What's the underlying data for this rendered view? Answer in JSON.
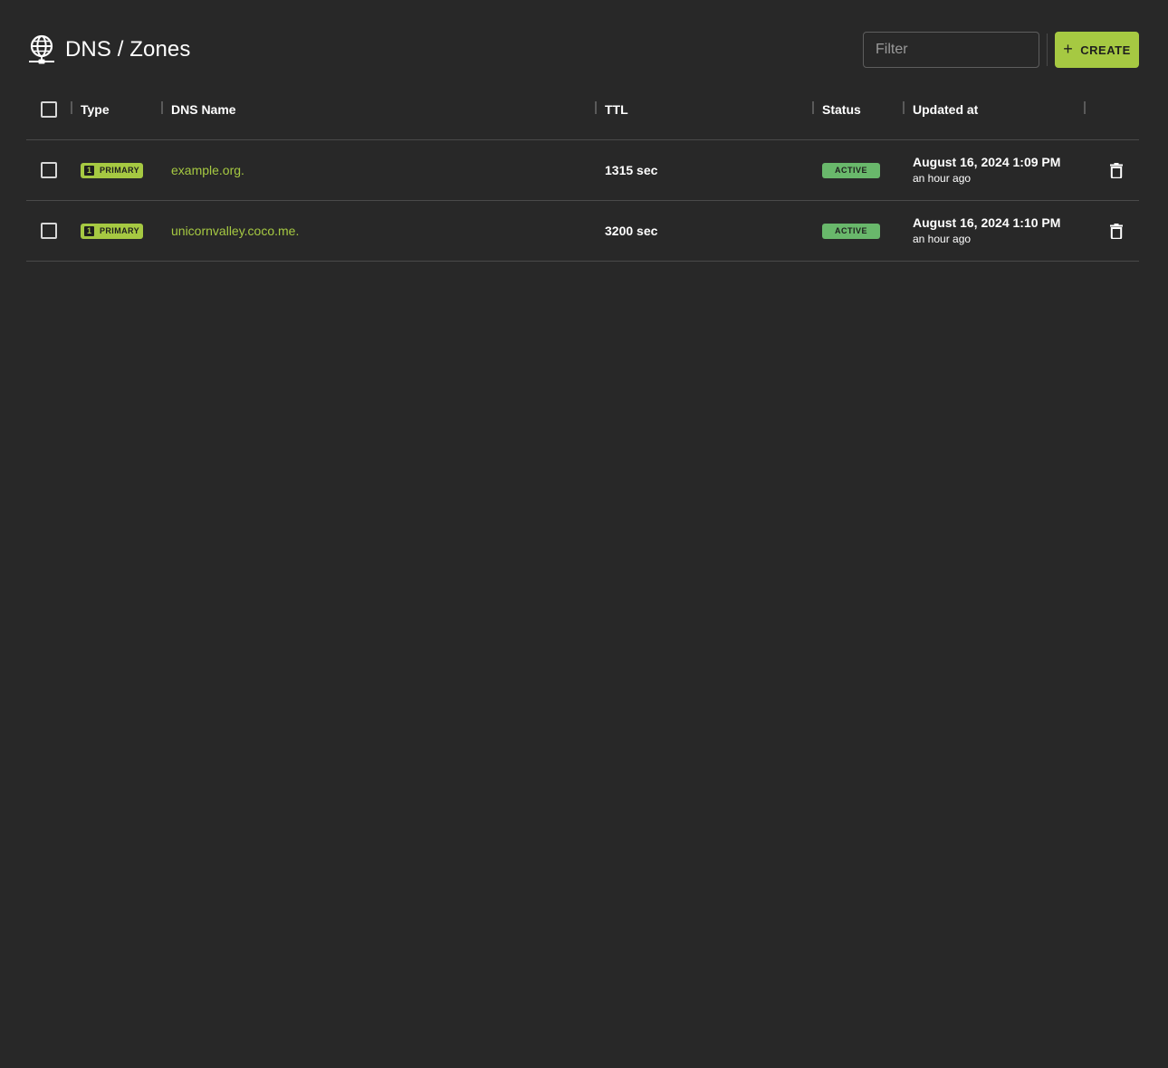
{
  "header": {
    "title": "DNS / Zones",
    "title_icon": "globe-network-icon",
    "filter_placeholder": "Filter",
    "filter_value": "",
    "create_label": "CREATE",
    "create_icon": "plus-icon"
  },
  "colors": {
    "background": "#282828",
    "accent": "#a6c942",
    "status_active": "#69b86b",
    "divider": "#4a4a4a"
  },
  "table": {
    "columns": [
      "Type",
      "DNS Name",
      "TTL",
      "Status",
      "Updated at"
    ],
    "rows": [
      {
        "type_number": "1",
        "type": "PRIMARY",
        "dns_name": "example.org.",
        "ttl": "1315 sec",
        "status": "ACTIVE",
        "updated_date": "August 16, 2024 1:09 PM",
        "updated_relative": "an hour ago",
        "action_icon": "trash-icon"
      },
      {
        "type_number": "1",
        "type": "PRIMARY",
        "dns_name": "unicornvalley.coco.me.",
        "ttl": "3200 sec",
        "status": "ACTIVE",
        "updated_date": "August 16, 2024 1:10 PM",
        "updated_relative": "an hour ago",
        "action_icon": "trash-icon"
      }
    ]
  }
}
